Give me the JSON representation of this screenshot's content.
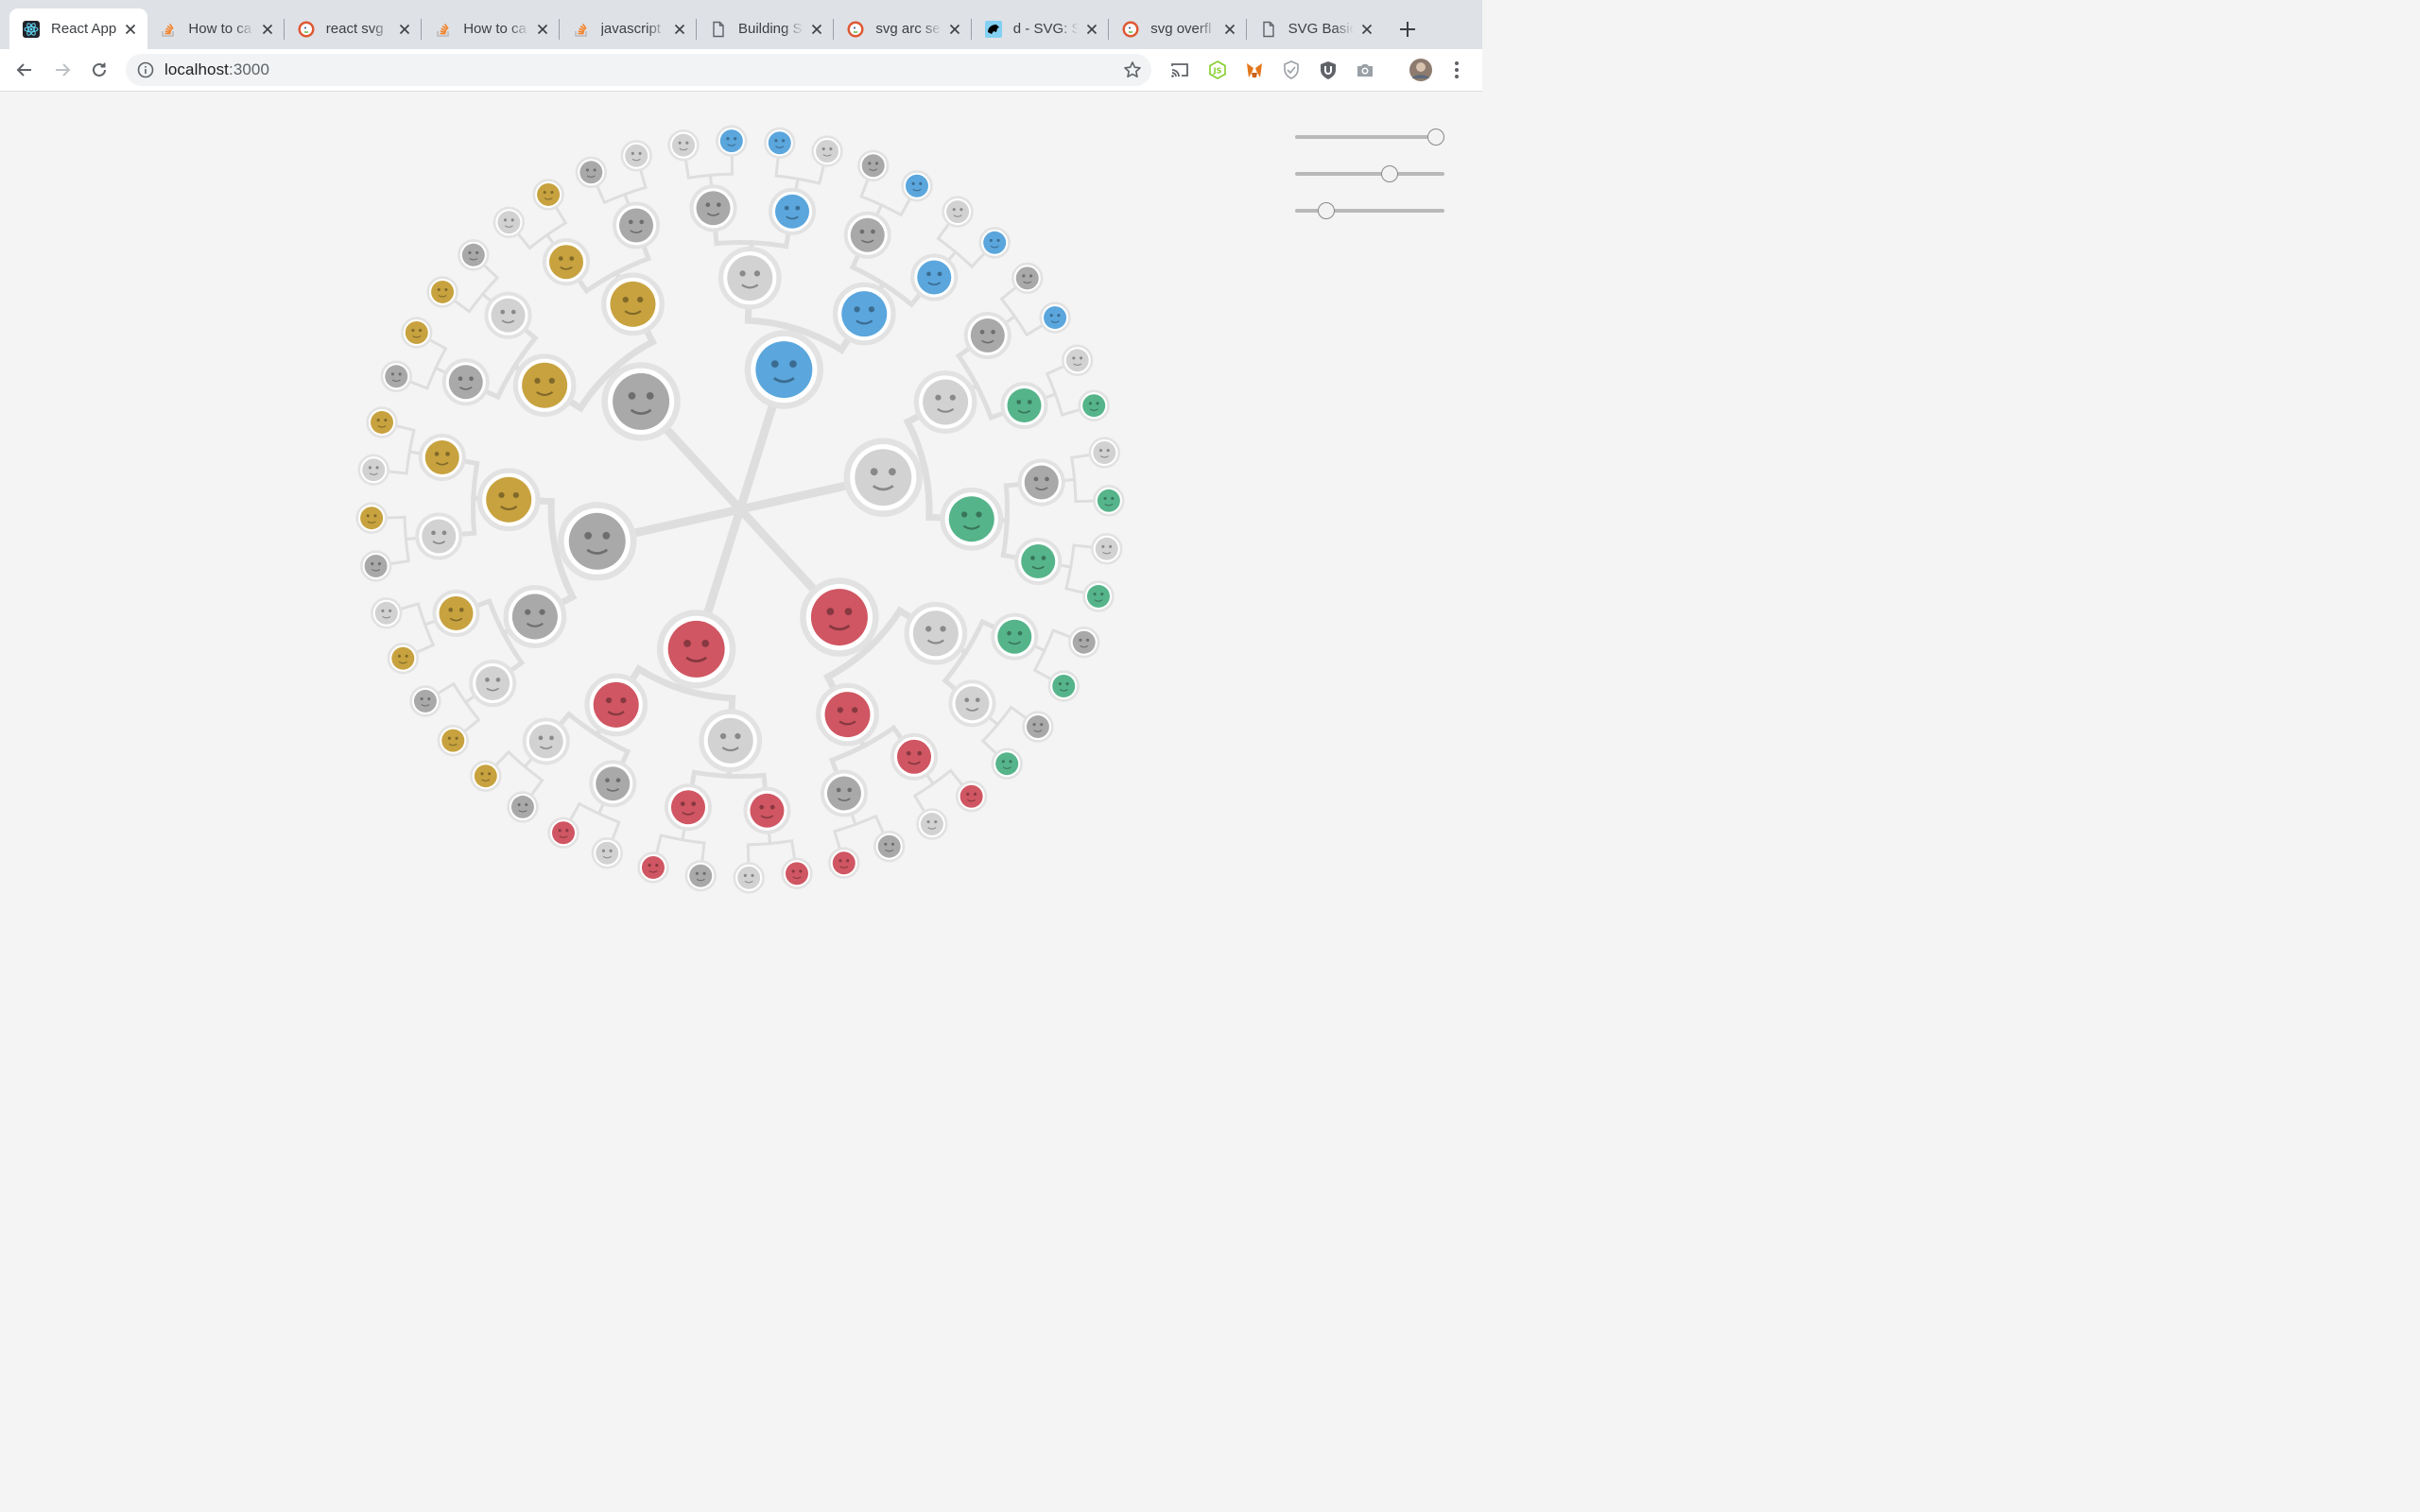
{
  "browser": {
    "tabs": [
      {
        "title": "React App",
        "favicon": "react-icon",
        "active": true
      },
      {
        "title": "How to ca",
        "favicon": "stackoverflow-icon"
      },
      {
        "title": "react svg",
        "favicon": "duckduckgo-icon"
      },
      {
        "title": "How to ca",
        "favicon": "stackoverflow-icon"
      },
      {
        "title": "javascript",
        "favicon": "stackoverflow-icon"
      },
      {
        "title": "Building S",
        "favicon": "document-icon"
      },
      {
        "title": "svg arc se",
        "favicon": "duckduckgo-icon"
      },
      {
        "title": "d - SVG: S",
        "favicon": "mdn-icon"
      },
      {
        "title": "svg overfl",
        "favicon": "duckduckgo-icon"
      },
      {
        "title": "SVG Basic",
        "favicon": "document-icon"
      }
    ],
    "address": {
      "host": "localhost",
      "port": ":3000"
    },
    "extensions": [
      "cast-icon",
      "nodejs-icon",
      "metamask-icon",
      "shield-icon",
      "ublock-icon",
      "camera-icon"
    ]
  },
  "controls": {
    "sliders": [
      {
        "name": "slider-1",
        "value": 1.0
      },
      {
        "name": "slider-2",
        "value": 0.65
      },
      {
        "name": "slider-3",
        "value": 0.17
      }
    ]
  },
  "colors": {
    "blue": "#5aa6dd",
    "teal": "#56b48a",
    "red": "#cf5662",
    "yellow": "#c7a23f",
    "gray": "#a9a9a9",
    "lightgray": "#d2d2d2"
  },
  "tree": {
    "branches": [
      {
        "color": "blue",
        "children": [
          {
            "color": "lightgray",
            "children": [
              {
                "color": "gray",
                "children": [
                  {
                    "color": "lightgray"
                  },
                  {
                    "color": "blue"
                  }
                ]
              },
              {
                "color": "blue",
                "children": [
                  {
                    "color": "blue"
                  },
                  {
                    "color": "lightgray"
                  }
                ]
              }
            ]
          },
          {
            "color": "blue",
            "children": [
              {
                "color": "gray",
                "children": [
                  {
                    "color": "gray"
                  },
                  {
                    "color": "blue"
                  }
                ]
              },
              {
                "color": "blue",
                "children": [
                  {
                    "color": "lightgray"
                  },
                  {
                    "color": "blue"
                  }
                ]
              }
            ]
          }
        ]
      },
      {
        "color": "lightgray",
        "children": [
          {
            "color": "lightgray",
            "children": [
              {
                "color": "gray",
                "children": [
                  {
                    "color": "gray"
                  },
                  {
                    "color": "blue"
                  }
                ]
              },
              {
                "color": "teal",
                "children": [
                  {
                    "color": "lightgray"
                  },
                  {
                    "color": "teal"
                  }
                ]
              }
            ]
          },
          {
            "color": "teal",
            "children": [
              {
                "color": "gray",
                "children": [
                  {
                    "color": "lightgray"
                  },
                  {
                    "color": "teal"
                  }
                ]
              },
              {
                "color": "teal",
                "children": [
                  {
                    "color": "lightgray"
                  },
                  {
                    "color": "teal"
                  }
                ]
              }
            ]
          }
        ]
      },
      {
        "color": "red",
        "children": [
          {
            "color": "lightgray",
            "children": [
              {
                "color": "teal",
                "children": [
                  {
                    "color": "gray"
                  },
                  {
                    "color": "teal"
                  }
                ]
              },
              {
                "color": "lightgray",
                "children": [
                  {
                    "color": "gray"
                  },
                  {
                    "color": "teal"
                  }
                ]
              }
            ]
          },
          {
            "color": "red",
            "children": [
              {
                "color": "red",
                "children": [
                  {
                    "color": "red"
                  },
                  {
                    "color": "lightgray"
                  }
                ]
              },
              {
                "color": "gray",
                "children": [
                  {
                    "color": "gray"
                  },
                  {
                    "color": "red"
                  }
                ]
              }
            ]
          }
        ]
      },
      {
        "color": "red",
        "children": [
          {
            "color": "lightgray",
            "children": [
              {
                "color": "red",
                "children": [
                  {
                    "color": "red"
                  },
                  {
                    "color": "lightgray"
                  }
                ]
              },
              {
                "color": "red",
                "children": [
                  {
                    "color": "gray"
                  },
                  {
                    "color": "red"
                  }
                ]
              }
            ]
          },
          {
            "color": "red",
            "children": [
              {
                "color": "gray",
                "children": [
                  {
                    "color": "lightgray"
                  },
                  {
                    "color": "red"
                  }
                ]
              },
              {
                "color": "lightgray",
                "children": [
                  {
                    "color": "gray"
                  },
                  {
                    "color": "yellow"
                  }
                ]
              }
            ]
          }
        ]
      },
      {
        "color": "gray",
        "children": [
          {
            "color": "gray",
            "children": [
              {
                "color": "lightgray",
                "children": [
                  {
                    "color": "yellow"
                  },
                  {
                    "color": "gray"
                  }
                ]
              },
              {
                "color": "yellow",
                "children": [
                  {
                    "color": "yellow"
                  },
                  {
                    "color": "lightgray"
                  }
                ]
              }
            ]
          },
          {
            "color": "yellow",
            "children": [
              {
                "color": "lightgray",
                "children": [
                  {
                    "color": "gray"
                  },
                  {
                    "color": "yellow"
                  }
                ]
              },
              {
                "color": "yellow",
                "children": [
                  {
                    "color": "lightgray"
                  },
                  {
                    "color": "yellow"
                  }
                ]
              }
            ]
          }
        ]
      },
      {
        "color": "gray",
        "children": [
          {
            "color": "yellow",
            "children": [
              {
                "color": "gray",
                "children": [
                  {
                    "color": "gray"
                  },
                  {
                    "color": "yellow"
                  }
                ]
              },
              {
                "color": "lightgray",
                "children": [
                  {
                    "color": "yellow"
                  },
                  {
                    "color": "gray"
                  }
                ]
              }
            ]
          },
          {
            "color": "yellow",
            "children": [
              {
                "color": "yellow",
                "children": [
                  {
                    "color": "lightgray"
                  },
                  {
                    "color": "yellow"
                  }
                ]
              },
              {
                "color": "gray",
                "children": [
                  {
                    "color": "gray"
                  },
                  {
                    "color": "lightgray"
                  }
                ]
              }
            ]
          }
        ]
      }
    ]
  }
}
